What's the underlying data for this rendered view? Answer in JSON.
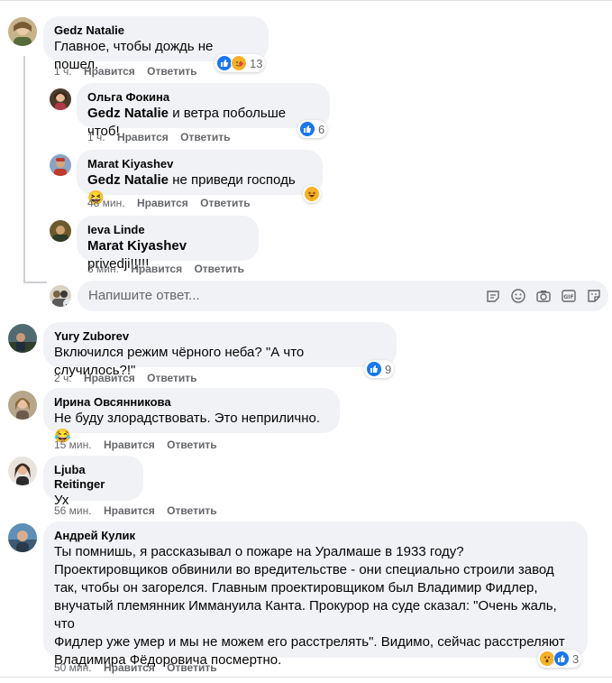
{
  "colors": {
    "like_blue": "#1877f2",
    "haha_yellow": "#f7b125",
    "bubble_bg": "#f0f2f5",
    "meta_gray": "#65676b"
  },
  "labels": {
    "like": "Нравится",
    "reply": "Ответить"
  },
  "comments": [
    {
      "author": "Gedz Natalie",
      "text": "Главное, чтобы дождь не пошел.",
      "time": "1 ч.",
      "reactions": [
        "like-icon",
        "care-icon"
      ],
      "count": "13"
    },
    {
      "author": "Ольга Фокина",
      "mention": "Gedz Natalie",
      "text": " и ветра побольше чтоб!",
      "time": "1 ч.",
      "reactions": [
        "like-icon"
      ],
      "count": "6"
    },
    {
      "author": "Marat Kiyashev",
      "mention": "Gedz Natalie",
      "text": " не приведи господь 😆",
      "time": "48 мин.",
      "reactions": [
        "haha-icon"
      ],
      "count": ""
    },
    {
      "author": "Ieva Linde",
      "mention": "Marat Kiyashev",
      "text": " privedji!!!!!",
      "time": "3 мин."
    },
    {
      "author": "Yury Zuborev",
      "text": "Включился режим чёрного неба? \"А что случилось?!\"",
      "time": "2 ч.",
      "reactions": [
        "like-icon"
      ],
      "count": "9"
    },
    {
      "author": "Ирина Овсянникова",
      "text": "Не буду злорадствовать. Это неприлично.😂",
      "time": "15 мин."
    },
    {
      "author": "Ljuba Reitinger",
      "text": "Ух",
      "time": "56 мин."
    },
    {
      "author": "Андрей Кулик",
      "lines": [
        "Ты помнишь, я рассказывал о пожаре на Уралмаше в 1933 году?",
        "Проектировщиков обвинили во вредительстве - они специально строили завод",
        "так, чтобы он загорелся. Главным проектировщиком был Владимир Фидлер,",
        "внучатый племянник Иммануила Канта. Прокурор на суде сказал: \"Очень жаль, что",
        "Фидлер уже умер и мы не можем его расстрелять\". Видимо, сейчас расстреляют",
        "Владимира Фёдоровича посмертно."
      ],
      "time": "50 мин.",
      "reactions": [
        "wow-icon",
        "like-icon"
      ],
      "count": "3"
    }
  ],
  "reply_input": {
    "placeholder": "Напишите ответ..."
  },
  "reply_tools": [
    "sticker-text-icon",
    "emoji-icon",
    "camera-icon",
    "gif-icon",
    "sticker-icon"
  ]
}
